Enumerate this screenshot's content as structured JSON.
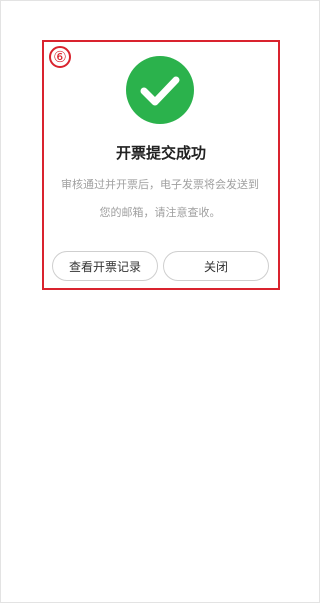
{
  "annotation": {
    "step_number": "⑥"
  },
  "dialog": {
    "title": "开票提交成功",
    "message_line1": "审核通过并开票后，电子发票将会发送到",
    "message_line2": "您的邮箱，请注意查收。",
    "buttons": {
      "view_records": "查看开票记录",
      "close": "关闭"
    }
  },
  "colors": {
    "success_green": "#2bb24c",
    "annotation_red": "#d9232e"
  },
  "icons": {
    "success": "check-circle-icon"
  }
}
